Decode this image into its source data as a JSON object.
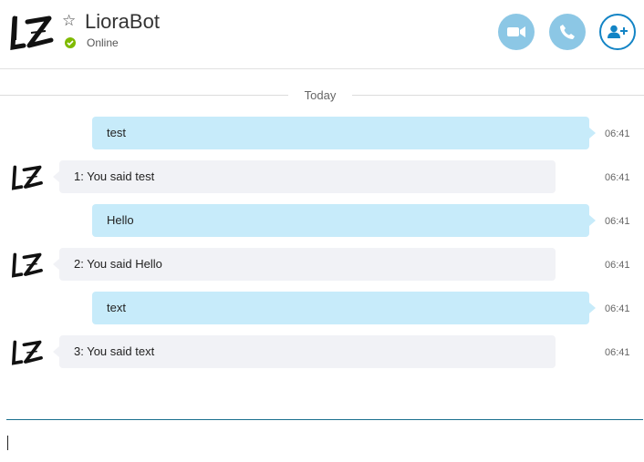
{
  "contact": {
    "name": "LioraBot",
    "status": "Online",
    "status_color": "#7fba00"
  },
  "header_actions": {
    "video_icon": "video-camera-icon",
    "call_icon": "phone-icon",
    "add_icon": "add-person-icon"
  },
  "divider": {
    "label": "Today"
  },
  "messages": [
    {
      "direction": "out",
      "text": "test",
      "time": "06:41"
    },
    {
      "direction": "in",
      "text": "1: You said test",
      "time": "06:41"
    },
    {
      "direction": "out",
      "text": "Hello",
      "time": "06:41"
    },
    {
      "direction": "in",
      "text": "2: You said Hello",
      "time": "06:41"
    },
    {
      "direction": "out",
      "text": "text",
      "time": "06:41"
    },
    {
      "direction": "in",
      "text": "3: You said text",
      "time": "06:41"
    }
  ],
  "compose": {
    "value": "",
    "placeholder": ""
  },
  "colors": {
    "outgoing_bubble": "#c7ebfa",
    "incoming_bubble": "#f1f2f6",
    "accent": "#1384c5",
    "action_button": "#8cc7e5"
  }
}
